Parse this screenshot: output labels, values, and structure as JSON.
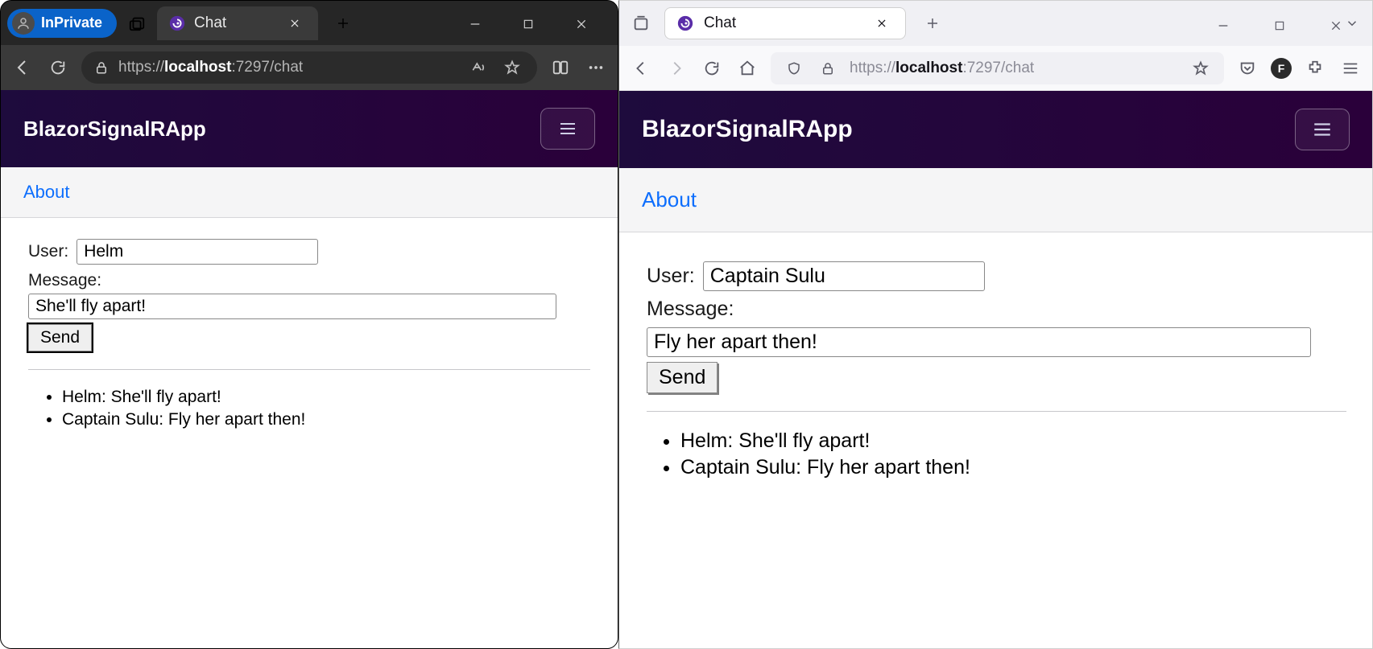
{
  "left": {
    "browser": {
      "inprivate_label": "InPrivate",
      "tab_title": "Chat",
      "url_prefix": "https://",
      "url_host": "localhost",
      "url_port_path": ":7297/chat"
    },
    "app": {
      "brand": "BlazorSignalRApp",
      "about_label": "About",
      "user_label": "User:",
      "user_value": "Helm",
      "message_label": "Message:",
      "message_value": "She'll fly apart!",
      "send_label": "Send",
      "messages": [
        "Helm: She'll fly apart!",
        "Captain Sulu: Fly her apart then!"
      ]
    }
  },
  "right": {
    "browser": {
      "tab_title": "Chat",
      "url_prefix": "https://",
      "url_host": "localhost",
      "url_port_path": ":7297/chat",
      "profile_initial": "F"
    },
    "app": {
      "brand": "BlazorSignalRApp",
      "about_label": "About",
      "user_label": "User:",
      "user_value": "Captain Sulu",
      "message_label": "Message:",
      "message_value": "Fly her apart then!",
      "send_label": "Send",
      "messages": [
        "Helm: She'll fly apart!",
        "Captain Sulu: Fly her apart then!"
      ]
    }
  }
}
